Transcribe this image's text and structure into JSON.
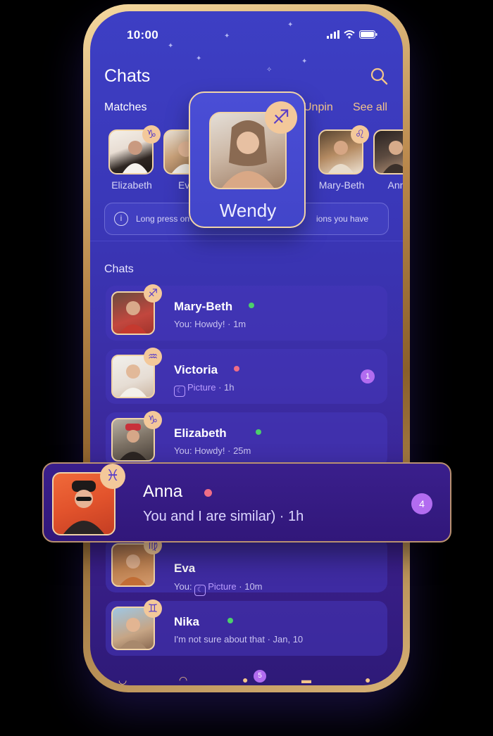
{
  "status_bar": {
    "time": "10:00"
  },
  "header": {
    "title": "Chats",
    "search_icon": "search-icon"
  },
  "matches": {
    "label": "Matches",
    "unpin_label": "Unpin",
    "see_all_label": "See all",
    "items": [
      {
        "name": "Elizabeth",
        "sign": "♑"
      },
      {
        "name": "Eva",
        "sign": "♍"
      },
      {
        "name": "Wendy",
        "sign": "♐"
      },
      {
        "name": "",
        "sign": "♏"
      },
      {
        "name": "Mary-Beth",
        "sign": "♌"
      },
      {
        "name": "Ann",
        "sign": ""
      }
    ]
  },
  "popup": {
    "name": "Wendy",
    "sign": "♐"
  },
  "info_bar": {
    "text_left": "Long press on",
    "text_right": "ions you have"
  },
  "chats": {
    "label": "Chats",
    "items": [
      {
        "name": "Mary-Beth",
        "status_color": "#4ccf6b",
        "preview_prefix": "You: Howdy!",
        "time": " · 1m",
        "sign": "♐",
        "unread": ""
      },
      {
        "name": "Victoria",
        "status_color": "#f06d86",
        "preview_prefix": "Picture",
        "time": " · 1h",
        "sign": "♒",
        "unread": "1"
      },
      {
        "name": "Elizabeth",
        "status_color": "#4ccf6b",
        "preview_prefix": "You: Howdy!",
        "time": " · 25m",
        "sign": "♑",
        "unread": ""
      },
      {
        "name": "Eva",
        "status_color": "#4ccf6b",
        "preview_you": "You:",
        "preview_prefix": "Picture",
        "time": " · 10m",
        "sign": "♍",
        "unread": ""
      },
      {
        "name": "Nika",
        "status_color": "#4ccf6b",
        "preview_prefix": "I'm not sure about that",
        "time": " · Jan, 10",
        "sign": "♊",
        "unread": ""
      }
    ]
  },
  "anna_card": {
    "name": "Anna",
    "status_color": "#f06d86",
    "preview": "You and I are similar) · 1h",
    "sign": "♓",
    "unread": "4"
  },
  "nav": {
    "badge": "5"
  },
  "colors": {
    "accent_gold": "#f3c58a",
    "badge_purple": "#b26cf0",
    "screen_bg": "#3b2da4"
  }
}
